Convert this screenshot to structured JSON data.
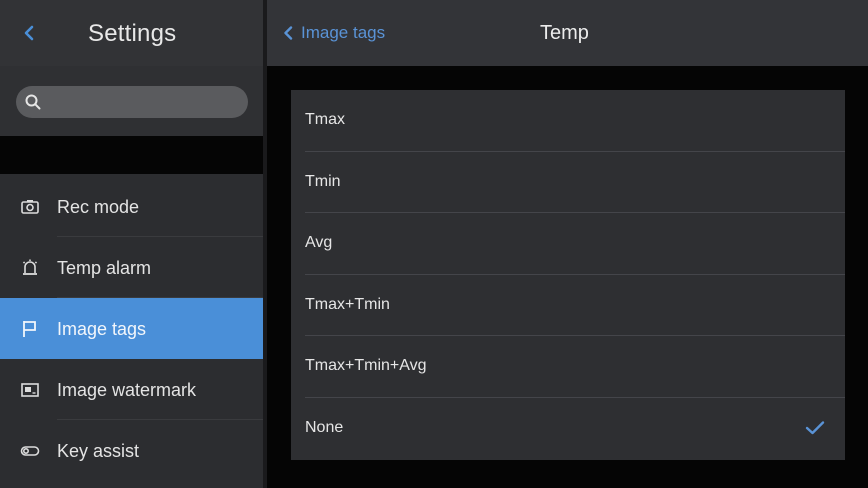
{
  "colors": {
    "accent": "#4a8fd8",
    "link": "#5a93d6"
  },
  "sidebar": {
    "title": "Settings",
    "search": {
      "placeholder": ""
    },
    "items": [
      {
        "label": "Rec mode",
        "icon": "camera-icon",
        "active": false
      },
      {
        "label": "Temp alarm",
        "icon": "alarm-icon",
        "active": false
      },
      {
        "label": "Image tags",
        "icon": "flag-icon",
        "active": true
      },
      {
        "label": "Image watermark",
        "icon": "watermark-icon",
        "active": false
      },
      {
        "label": "Key assist",
        "icon": "toggle-icon",
        "active": false
      }
    ]
  },
  "header": {
    "back_label": "Image tags",
    "title": "Temp"
  },
  "options": [
    {
      "label": "Tmax",
      "selected": false
    },
    {
      "label": "Tmin",
      "selected": false
    },
    {
      "label": "Avg",
      "selected": false
    },
    {
      "label": "Tmax+Tmin",
      "selected": false
    },
    {
      "label": "Tmax+Tmin+Avg",
      "selected": false
    },
    {
      "label": "None",
      "selected": true
    }
  ]
}
